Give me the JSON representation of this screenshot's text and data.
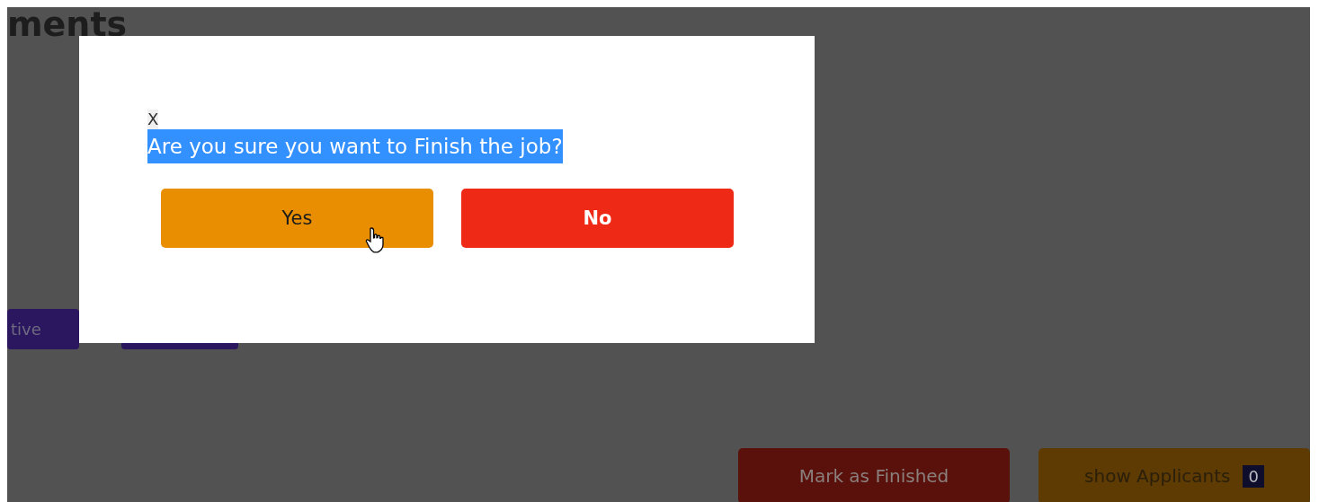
{
  "page": {
    "heading": "ments",
    "status_buttons": [
      {
        "label": "tive"
      }
    ],
    "actions": [
      {
        "kind": "finish",
        "label": "Mark as Finished"
      },
      {
        "kind": "applicants",
        "label": "show Applicants",
        "count": "0"
      }
    ]
  },
  "dialog": {
    "close": "X",
    "message": "Are you sure you want to Finish the job?",
    "message_highlighted": true,
    "buttons": [
      {
        "kind": "confirm",
        "label": "Yes",
        "hovered": true
      },
      {
        "kind": "cancel",
        "label": "No",
        "hovered": false
      }
    ]
  }
}
